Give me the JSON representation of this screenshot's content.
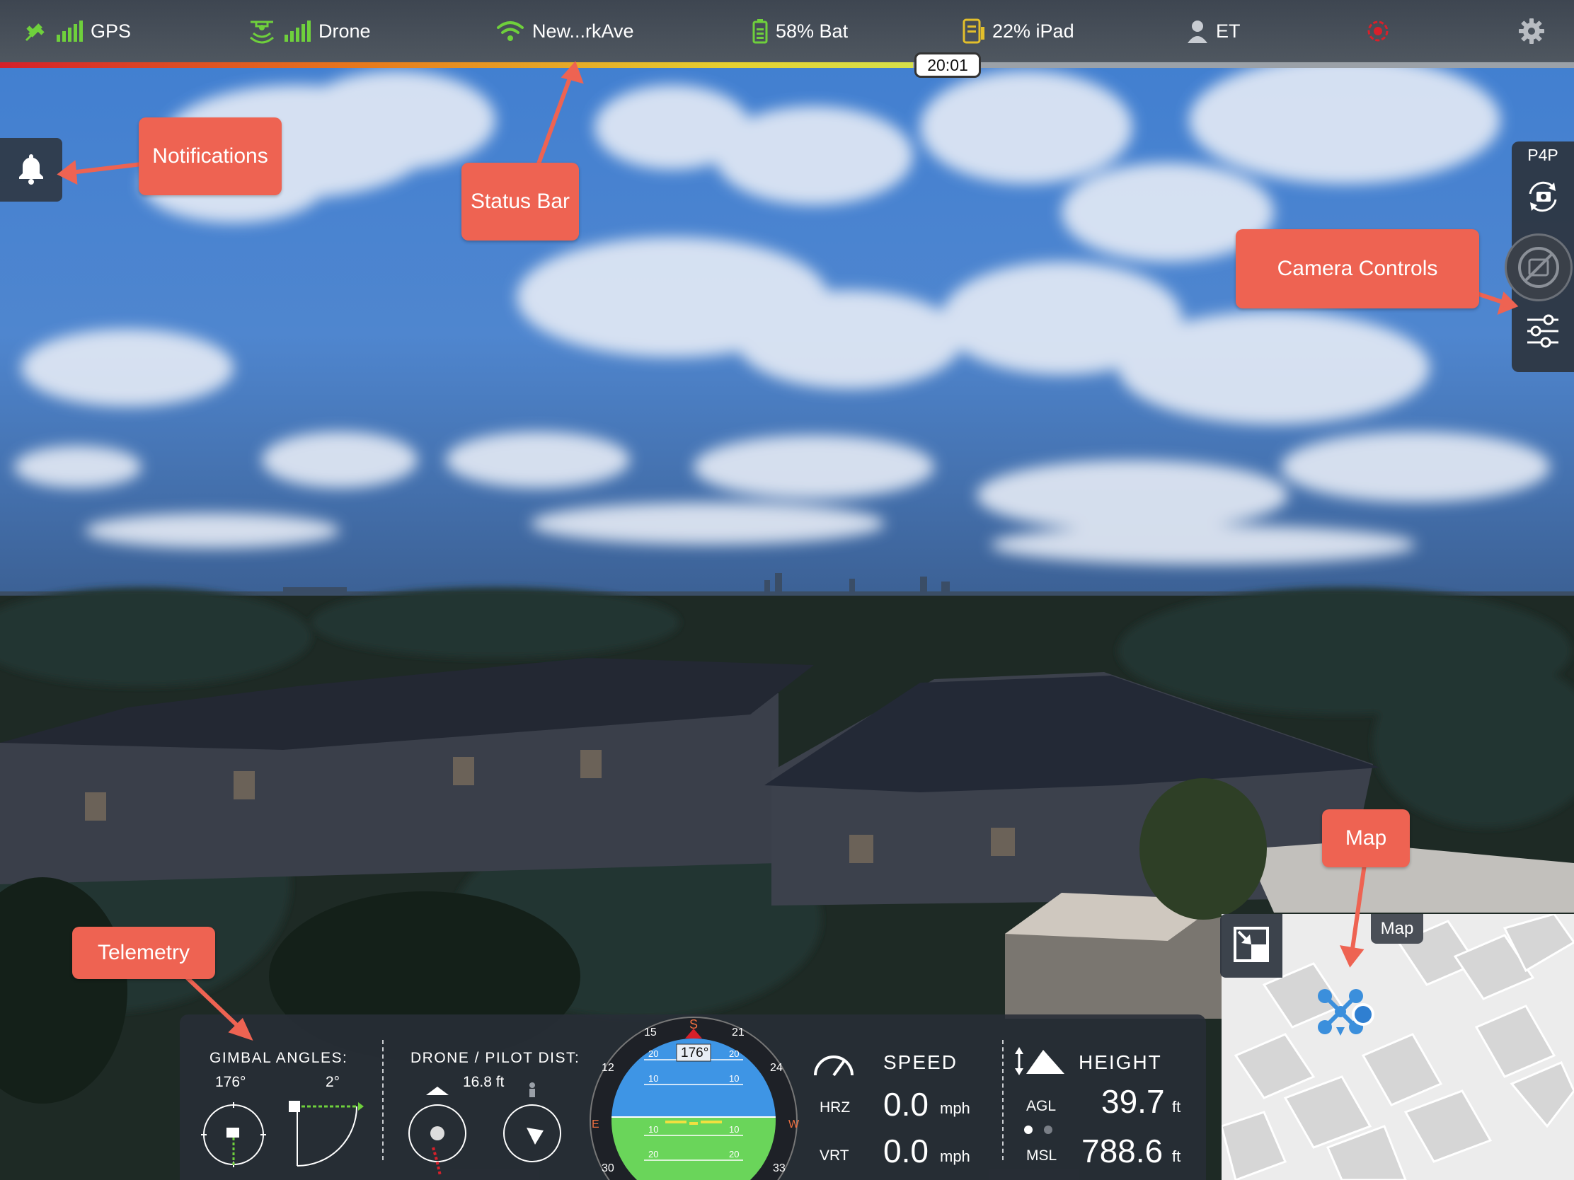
{
  "status_bar": {
    "gps_label": "GPS",
    "drone_label": "Drone",
    "wifi_label": "New...rkAve",
    "battery_label": "58% Bat",
    "ipad_label": "22% iPad",
    "user_label": "ET",
    "flight_time": "20:01",
    "battery_progress_fraction": 0.58,
    "icons": [
      "satellite-icon",
      "signal-bars-icon",
      "drone-icon",
      "wifi-icon",
      "battery-icon",
      "tablet-battery-icon",
      "user-icon",
      "record-target-icon",
      "gear-icon"
    ],
    "colors": {
      "ok": "#6fd03c",
      "alert": "#d8202a"
    }
  },
  "callouts": {
    "notifications": "Notifications",
    "status_bar": "Status Bar",
    "camera_controls": "Camera Controls",
    "map": "Map",
    "telemetry": "Telemetry",
    "color": "#ee6352"
  },
  "camera_controls": {
    "model": "P4P",
    "icons": [
      "camera-switch-icon",
      "shutter-disabled-icon",
      "settings-sliders-icon"
    ]
  },
  "map": {
    "label": "Map",
    "icons": [
      "expand-map-icon",
      "drone-marker-icon",
      "pilot-location-icon"
    ]
  },
  "telemetry": {
    "gimbal": {
      "header": "GIMBAL ANGLES:",
      "yaw": "176°",
      "pitch": "2°"
    },
    "distance": {
      "header": "DRONE / PILOT DIST:",
      "value": "16.8 ft"
    },
    "compass": {
      "heading": "176°",
      "cardinal": [
        "S",
        "W",
        "E"
      ],
      "ticks": [
        "15",
        "21",
        "24",
        "12",
        "30",
        "33"
      ],
      "pitch_ticks": [
        "20",
        "10",
        "10",
        "20"
      ]
    },
    "speed": {
      "header": "SPEED",
      "hrz_label": "HRZ",
      "vrt_label": "VRT",
      "hrz": "0.0",
      "vrt": "0.0",
      "unit": "mph"
    },
    "height": {
      "header": "HEIGHT",
      "agl_label": "AGL",
      "msl_label": "MSL",
      "agl": "39.7",
      "msl": "788.6",
      "unit": "ft"
    }
  }
}
